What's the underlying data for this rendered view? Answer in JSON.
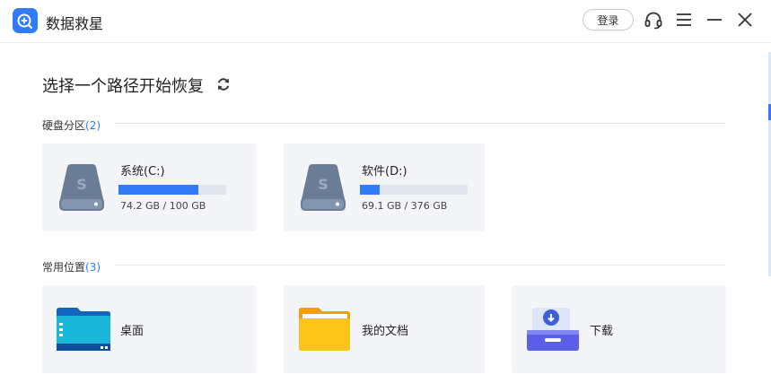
{
  "app": {
    "title": "数据救星"
  },
  "header": {
    "login_label": "登录"
  },
  "main": {
    "heading": "选择一个路径开始恢复"
  },
  "partitions": {
    "label": "硬盘分区",
    "count": "(2)",
    "drives": [
      {
        "name": "系统(C:)",
        "size": "74.2 GB / 100 GB",
        "used_fraction": 0.742
      },
      {
        "name": "软件(D:)",
        "size": "69.1 GB / 376 GB",
        "used_fraction": 0.184
      }
    ]
  },
  "locations": {
    "label": "常用位置",
    "count": "(3)",
    "items": [
      {
        "name": "桌面",
        "icon": "desktop-folder-icon"
      },
      {
        "name": "我的文档",
        "icon": "documents-folder-icon"
      },
      {
        "name": "下载",
        "icon": "download-tray-icon"
      }
    ]
  },
  "colors": {
    "accent": "#2f7cf6",
    "card_bg": "#f4f5f8",
    "drive_icon": "#6b7d96"
  }
}
